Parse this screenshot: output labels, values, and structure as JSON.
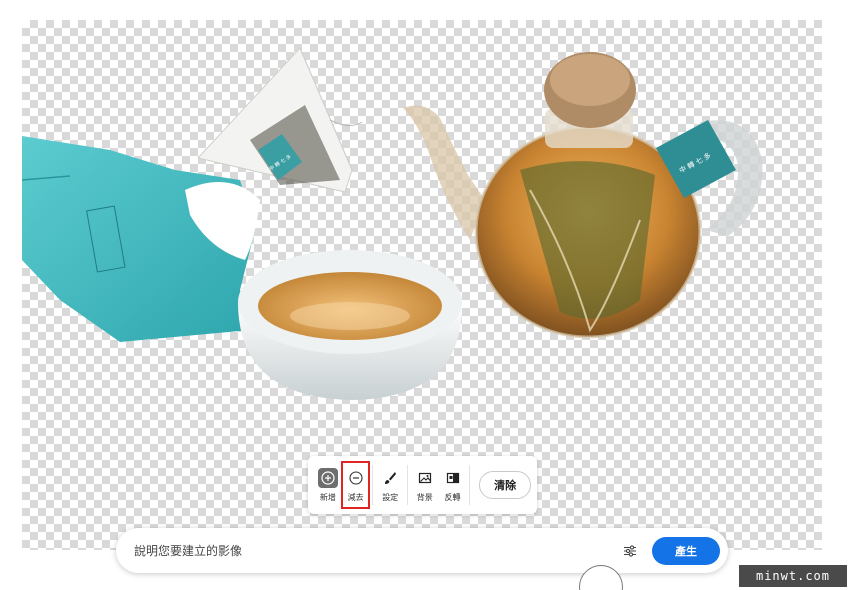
{
  "toolbar": {
    "tools": [
      {
        "label": "新增",
        "icon": "plus-circle-icon",
        "selected": true
      },
      {
        "label": "減去",
        "icon": "minus-circle-icon",
        "selected": false,
        "highlighted": true
      },
      {
        "label": "設定",
        "icon": "brush-icon",
        "selected": false
      },
      {
        "label": "背景",
        "icon": "image-icon",
        "selected": false
      },
      {
        "label": "反轉",
        "icon": "invert-icon",
        "selected": false
      }
    ],
    "clear_label": "清除"
  },
  "prompt": {
    "placeholder": "說明您要建立的影像",
    "generate_label": "產生",
    "settings_icon": "sliders-icon"
  },
  "watermark": "minwt.com",
  "colors": {
    "accent": "#1473e6",
    "highlight": "#e02424",
    "checker": "#d9d9d9",
    "tea_bag": "#3fb8be"
  }
}
